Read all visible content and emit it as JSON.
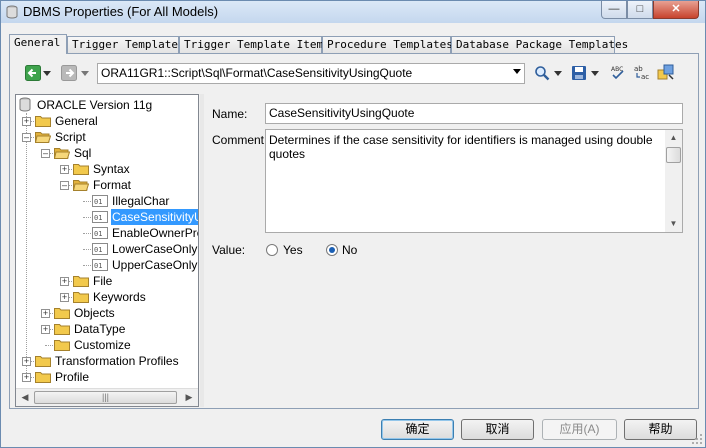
{
  "window": {
    "title": "DBMS Properties (For All Models)"
  },
  "tabs": [
    {
      "label": "General",
      "active": true
    },
    {
      "label": "Trigger Templates",
      "active": false
    },
    {
      "label": "Trigger Template Items",
      "active": false
    },
    {
      "label": "Procedure Templates",
      "active": false
    },
    {
      "label": "Database Package Templates",
      "active": false
    }
  ],
  "toolbar": {
    "path": "ORA11GR1::Script\\Sql\\Format\\CaseSensitivityUsingQuote",
    "icons": [
      "back-arrow-icon",
      "forward-arrow-icon",
      "dropdown-arrow-icon",
      "find-icon",
      "save-icon",
      "spell-check-icon",
      "replace-icon",
      "properties-icon"
    ]
  },
  "tree": {
    "root": "ORACLE Version 11g",
    "nodes": [
      {
        "label": "General",
        "level": 1,
        "expander": "+",
        "icon": "folder"
      },
      {
        "label": "Script",
        "level": 1,
        "expander": "-",
        "icon": "folder-open"
      },
      {
        "label": "Sql",
        "level": 2,
        "expander": "-",
        "icon": "folder-open"
      },
      {
        "label": "Syntax",
        "level": 3,
        "expander": "+",
        "icon": "folder"
      },
      {
        "label": "Format",
        "level": 3,
        "expander": "-",
        "icon": "folder-open"
      },
      {
        "label": "IllegalChar",
        "level": 4,
        "expander": "",
        "icon": "item"
      },
      {
        "label": "CaseSensitivityU",
        "level": 4,
        "expander": "",
        "icon": "item",
        "selected": true
      },
      {
        "label": "EnableOwnerPre",
        "level": 4,
        "expander": "",
        "icon": "item"
      },
      {
        "label": "LowerCaseOnly",
        "level": 4,
        "expander": "",
        "icon": "item"
      },
      {
        "label": "UpperCaseOnly",
        "level": 4,
        "expander": "",
        "icon": "item"
      },
      {
        "label": "File",
        "level": 3,
        "expander": "+",
        "icon": "folder"
      },
      {
        "label": "Keywords",
        "level": 3,
        "expander": "+",
        "icon": "folder"
      },
      {
        "label": "Objects",
        "level": 2,
        "expander": "+",
        "icon": "folder"
      },
      {
        "label": "DataType",
        "level": 2,
        "expander": "+",
        "icon": "folder"
      },
      {
        "label": "Customize",
        "level": 2,
        "expander": "",
        "icon": "folder"
      },
      {
        "label": "Transformation Profiles",
        "level": 1,
        "expander": "+",
        "icon": "folder"
      },
      {
        "label": "Profile",
        "level": 1,
        "expander": "+",
        "icon": "folder"
      }
    ]
  },
  "fields": {
    "name_label": "Name:",
    "name_value": "CaseSensitivityUsingQuote",
    "comment_label": "Comment:",
    "comment_value": "Determines if the case sensitivity for identifiers is managed using double quotes",
    "value_label": "Value:",
    "value_options": [
      {
        "label": "Yes",
        "checked": false
      },
      {
        "label": "No",
        "checked": true
      }
    ]
  },
  "buttons": {
    "ok": "确定",
    "cancel": "取消",
    "apply": "应用(A)",
    "help": "帮助"
  },
  "colors": {
    "selection": "#3399ff",
    "folder": "#f2c94c",
    "title_gradient_top": "#dbe8f7"
  }
}
